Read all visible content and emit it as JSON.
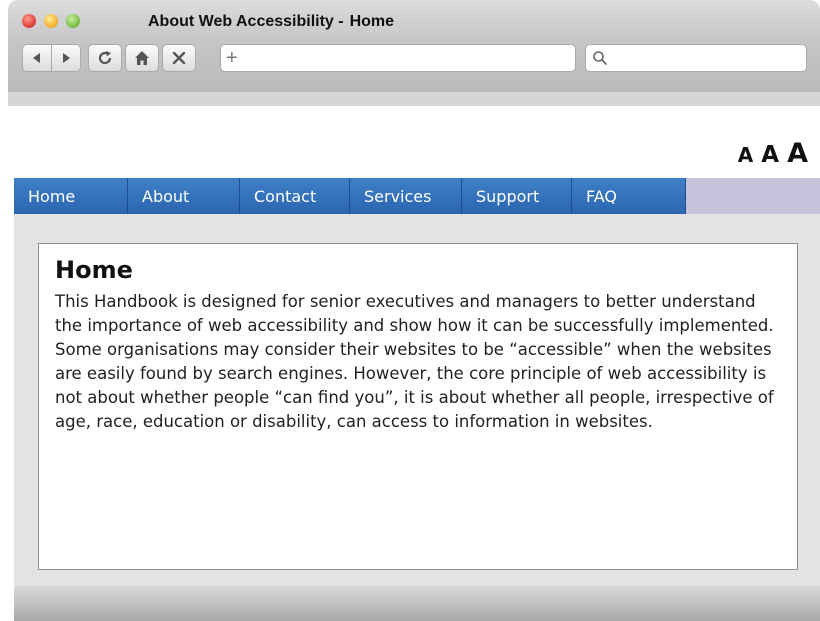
{
  "window": {
    "title": "About Web Accessibility -",
    "title_page": "Home"
  },
  "toolbar": {
    "back_icon": "back-arrow-icon",
    "forward_icon": "forward-arrow-icon",
    "reload_icon": "reload-icon",
    "home_icon": "home-icon",
    "stop_icon": "close-icon",
    "new_tab_label": "+",
    "address_value": "",
    "search_value": ""
  },
  "font_size_controls": {
    "small": "A",
    "medium": "A",
    "large": "A"
  },
  "nav": {
    "items": [
      {
        "label": "Home"
      },
      {
        "label": "About"
      },
      {
        "label": "Contact"
      },
      {
        "label": "Services"
      },
      {
        "label": "Support"
      },
      {
        "label": "FAQ"
      }
    ]
  },
  "main": {
    "heading": "Home",
    "body": "This Handbook is designed for senior executives and managers to better understand the importance of web accessibility and show how it can be successfully implemented. Some organisations may consider their websites to be “accessible” when the websites are easily found by search engines. However, the core principle of web accessibility is not about whether people “can find you”, it is about whether all people, irrespective of age, race, education or disability, can access to information in websites."
  },
  "colors": {
    "nav_blue": "#2c66b0",
    "nav_filler": "#c8c3dc"
  }
}
